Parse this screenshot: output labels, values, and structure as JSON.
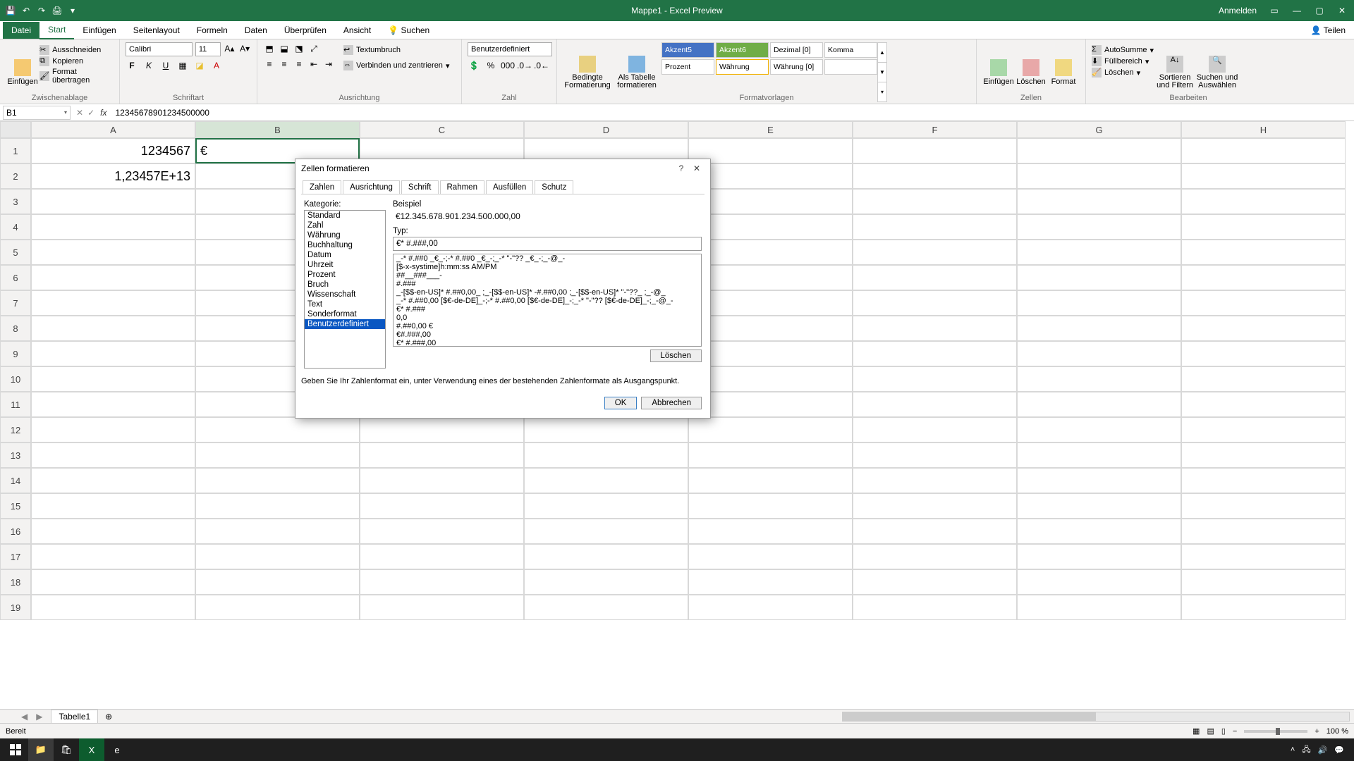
{
  "titlebar": {
    "title": "Mappe1  -  Excel Preview",
    "account": "Anmelden"
  },
  "ribbon_tabs": {
    "file": "Datei",
    "start": "Start",
    "insert": "Einfügen",
    "layout": "Seitenlayout",
    "formulas": "Formeln",
    "data": "Daten",
    "review": "Überprüfen",
    "view": "Ansicht",
    "search": "Suchen",
    "share": "Teilen"
  },
  "ribbon": {
    "clipboard": {
      "paste": "Einfügen",
      "cut": "Ausschneiden",
      "copy": "Kopieren",
      "formatp": "Format übertragen",
      "group": "Zwischenablage"
    },
    "font": {
      "name": "Calibri",
      "size": "11",
      "group": "Schriftart"
    },
    "align": {
      "wrap": "Textumbruch",
      "merge": "Verbinden und zentrieren",
      "group": "Ausrichtung"
    },
    "number": {
      "format": "Benutzerdefiniert",
      "group": "Zahl"
    },
    "styles": {
      "cond": "Bedingte Formatierung",
      "table": "Als Tabelle formatieren",
      "a5": "Akzent5",
      "a6": "Akzent6",
      "dez": "Dezimal [0]",
      "komma": "Komma",
      "prozent": "Prozent",
      "wahrung": "Währung",
      "wahrung0": "Währung [0]",
      "group": "Formatvorlagen"
    },
    "cells": {
      "insert": "Einfügen",
      "delete": "Löschen",
      "format": "Format",
      "group": "Zellen"
    },
    "editing": {
      "sum": "AutoSumme",
      "fill": "Füllbereich",
      "clear": "Löschen",
      "sort": "Sortieren und Filtern",
      "find": "Suchen und Auswählen",
      "group": "Bearbeiten"
    }
  },
  "formula_bar": {
    "cell_ref": "B1",
    "value": "12345678901234500000"
  },
  "columns": [
    "A",
    "B",
    "C",
    "D",
    "E",
    "F",
    "G",
    "H"
  ],
  "rows": [
    {
      "h": "1",
      "a": "1234567",
      "b": "€"
    },
    {
      "h": "2",
      "a": "1,23457E+13",
      "b": ""
    },
    {
      "h": "3",
      "a": "",
      "b": ""
    },
    {
      "h": "4",
      "a": "",
      "b": ""
    },
    {
      "h": "5",
      "a": "",
      "b": ""
    },
    {
      "h": "6",
      "a": "",
      "b": ""
    },
    {
      "h": "7",
      "a": "",
      "b": ""
    },
    {
      "h": "8",
      "a": "",
      "b": ""
    },
    {
      "h": "9",
      "a": "",
      "b": ""
    },
    {
      "h": "10",
      "a": "",
      "b": ""
    },
    {
      "h": "11",
      "a": "",
      "b": ""
    },
    {
      "h": "12",
      "a": "",
      "b": ""
    },
    {
      "h": "13",
      "a": "",
      "b": ""
    },
    {
      "h": "14",
      "a": "",
      "b": ""
    },
    {
      "h": "15",
      "a": "",
      "b": ""
    },
    {
      "h": "16",
      "a": "",
      "b": ""
    },
    {
      "h": "17",
      "a": "",
      "b": ""
    },
    {
      "h": "18",
      "a": "",
      "b": ""
    },
    {
      "h": "19",
      "a": "",
      "b": ""
    }
  ],
  "sheettab": "Tabelle1",
  "status": {
    "ready": "Bereit",
    "zoom": "100 %"
  },
  "dialog": {
    "title": "Zellen formatieren",
    "tabs": {
      "zahlen": "Zahlen",
      "ausrichtung": "Ausrichtung",
      "schrift": "Schrift",
      "rahmen": "Rahmen",
      "ausfullen": "Ausfüllen",
      "schutz": "Schutz"
    },
    "category_label": "Kategorie:",
    "categories": [
      "Standard",
      "Zahl",
      "Währung",
      "Buchhaltung",
      "Datum",
      "Uhrzeit",
      "Prozent",
      "Bruch",
      "Wissenschaft",
      "Text",
      "Sonderformat",
      "Benutzerdefiniert"
    ],
    "selected_category_idx": 11,
    "preview_label": "Beispiel",
    "preview_value": "€12.345.678.901.234.500.000,00",
    "type_label": "Typ:",
    "type_value": "€* #.###,00",
    "type_list": [
      "_-* #.##0 _€_-;-* #.##0 _€_-;_-* \"-\"?? _€_-;_-@_-",
      "[$-x-systime]h:mm:ss AM/PM",
      "##__###___-",
      "#.###",
      "_-[$$-en-US]* #.##0,00_ ;_-[$$-en-US]* -#.##0,00 ;_-[$$-en-US]* \"-\"??_ ;_-@_",
      "_-* #.##0,00 [$€-de-DE]_-;-* #.##0,00 [$€-de-DE]_-;_-* \"-\"?? [$€-de-DE]_-;_-@_-",
      "€* #.###",
      "0,0",
      "#.##0,00 €",
      "€#.###,00",
      "€* #.###,00"
    ],
    "delete": "Löschen",
    "hint": "Geben Sie Ihr Zahlenformat ein, unter Verwendung eines der bestehenden Zahlenformate als Ausgangspunkt.",
    "ok": "OK",
    "cancel": "Abbrechen"
  }
}
